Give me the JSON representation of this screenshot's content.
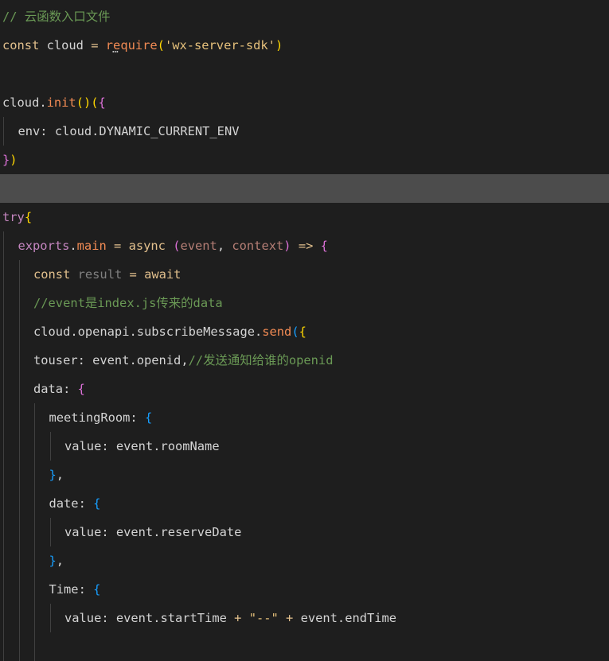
{
  "editor": {
    "lines": [
      {
        "indent": 0,
        "highlight": false,
        "tokens": [
          {
            "t": "// 云函数入口文件",
            "c": "cmt"
          }
        ]
      },
      {
        "indent": 0,
        "highlight": false,
        "tokens": [
          {
            "t": "const",
            "c": "kw"
          },
          {
            "t": " cloud ",
            "c": "plain"
          },
          {
            "t": "=",
            "c": "op"
          },
          {
            "t": " ",
            "c": "plain"
          },
          {
            "t": "require",
            "c": "fn"
          },
          {
            "t": "(",
            "c": "b1"
          },
          {
            "t": "'wx-server-sdk'",
            "c": "str"
          },
          {
            "t": ")",
            "c": "b1"
          }
        ]
      },
      {
        "indent": 0,
        "highlight": false,
        "tokens": []
      },
      {
        "indent": 0,
        "highlight": false,
        "tokens": [
          {
            "t": "cloud.",
            "c": "plain"
          },
          {
            "t": "init",
            "c": "fn"
          },
          {
            "t": "()",
            "c": "b1"
          },
          {
            "t": "(",
            "c": "b1"
          },
          {
            "t": "{",
            "c": "b2"
          }
        ]
      },
      {
        "indent": 1,
        "highlight": false,
        "tokens": [
          {
            "t": "env: cloud.DYNAMIC_CURRENT_ENV",
            "c": "plain"
          }
        ]
      },
      {
        "indent": 0,
        "highlight": false,
        "tokens": [
          {
            "t": "}",
            "c": "b2"
          },
          {
            "t": ")",
            "c": "b1"
          }
        ]
      },
      {
        "indent": 0,
        "highlight": true,
        "tokens": []
      },
      {
        "indent": 0,
        "highlight": false,
        "tokens": [
          {
            "t": "try",
            "c": "ctrl"
          },
          {
            "t": "{",
            "c": "b1"
          }
        ]
      },
      {
        "indent": 1,
        "highlight": false,
        "tokens": [
          {
            "t": "exports",
            "c": "ctrl"
          },
          {
            "t": ".",
            "c": "plain"
          },
          {
            "t": "main",
            "c": "fn"
          },
          {
            "t": " ",
            "c": "plain"
          },
          {
            "t": "=",
            "c": "op"
          },
          {
            "t": " ",
            "c": "plain"
          },
          {
            "t": "async",
            "c": "kw"
          },
          {
            "t": " ",
            "c": "plain"
          },
          {
            "t": "(",
            "c": "b2"
          },
          {
            "t": "event",
            "c": "param"
          },
          {
            "t": ", ",
            "c": "plain"
          },
          {
            "t": "context",
            "c": "param"
          },
          {
            "t": ")",
            "c": "b2"
          },
          {
            "t": " ",
            "c": "plain"
          },
          {
            "t": "=>",
            "c": "op"
          },
          {
            "t": " ",
            "c": "plain"
          },
          {
            "t": "{",
            "c": "b2"
          }
        ]
      },
      {
        "indent": 2,
        "highlight": false,
        "tokens": [
          {
            "t": "const",
            "c": "kw"
          },
          {
            "t": " ",
            "c": "plain"
          },
          {
            "t": "result",
            "c": "dim"
          },
          {
            "t": " ",
            "c": "plain"
          },
          {
            "t": "=",
            "c": "op"
          },
          {
            "t": " ",
            "c": "plain"
          },
          {
            "t": "await",
            "c": "kw"
          }
        ]
      },
      {
        "indent": 2,
        "highlight": false,
        "tokens": [
          {
            "t": "//event是index.js传来的data",
            "c": "cmt"
          }
        ]
      },
      {
        "indent": 2,
        "highlight": false,
        "tokens": [
          {
            "t": "cloud.openapi.subscribeMessage.",
            "c": "plain"
          },
          {
            "t": "send",
            "c": "fn"
          },
          {
            "t": "(",
            "c": "b3"
          },
          {
            "t": "{",
            "c": "b1"
          }
        ]
      },
      {
        "indent": 2,
        "highlight": false,
        "tokens": [
          {
            "t": "touser: event.openid,",
            "c": "plain"
          },
          {
            "t": "//发送通知给谁的openid",
            "c": "cmt"
          }
        ]
      },
      {
        "indent": 2,
        "highlight": false,
        "tokens": [
          {
            "t": "data: ",
            "c": "plain"
          },
          {
            "t": "{",
            "c": "b2"
          }
        ]
      },
      {
        "indent": 3,
        "highlight": false,
        "tokens": [
          {
            "t": "meetingRoom: ",
            "c": "plain"
          },
          {
            "t": "{",
            "c": "b3"
          }
        ]
      },
      {
        "indent": 4,
        "highlight": false,
        "tokens": [
          {
            "t": "value: event.roomName",
            "c": "plain"
          }
        ]
      },
      {
        "indent": 3,
        "highlight": false,
        "tokens": [
          {
            "t": "}",
            "c": "b3"
          },
          {
            "t": ",",
            "c": "plain"
          }
        ]
      },
      {
        "indent": 3,
        "highlight": false,
        "tokens": [
          {
            "t": "date: ",
            "c": "plain"
          },
          {
            "t": "{",
            "c": "b3"
          }
        ]
      },
      {
        "indent": 4,
        "highlight": false,
        "tokens": [
          {
            "t": "value: event.reserveDate",
            "c": "plain"
          }
        ]
      },
      {
        "indent": 3,
        "highlight": false,
        "tokens": [
          {
            "t": "}",
            "c": "b3"
          },
          {
            "t": ",",
            "c": "plain"
          }
        ]
      },
      {
        "indent": 3,
        "highlight": false,
        "tokens": [
          {
            "t": "Time: ",
            "c": "plain"
          },
          {
            "t": "{",
            "c": "b3"
          }
        ]
      },
      {
        "indent": 4,
        "highlight": false,
        "tokens": [
          {
            "t": "value: event.startTime ",
            "c": "plain"
          },
          {
            "t": "+",
            "c": "op"
          },
          {
            "t": " ",
            "c": "plain"
          },
          {
            "t": "\"--\"",
            "c": "str"
          },
          {
            "t": " ",
            "c": "plain"
          },
          {
            "t": "+",
            "c": "op"
          },
          {
            "t": " event.endTime",
            "c": "plain"
          }
        ]
      },
      {
        "indent": 3,
        "highlight": false,
        "tokens": []
      }
    ]
  },
  "colors": {
    "background": "#1e1e1e",
    "highlight_line": "#4c4c4c",
    "comment": "#6a9955",
    "keyword": "#e2c08d",
    "control": "#c586c0",
    "function": "#f28b54",
    "string": "#e5c07b"
  }
}
